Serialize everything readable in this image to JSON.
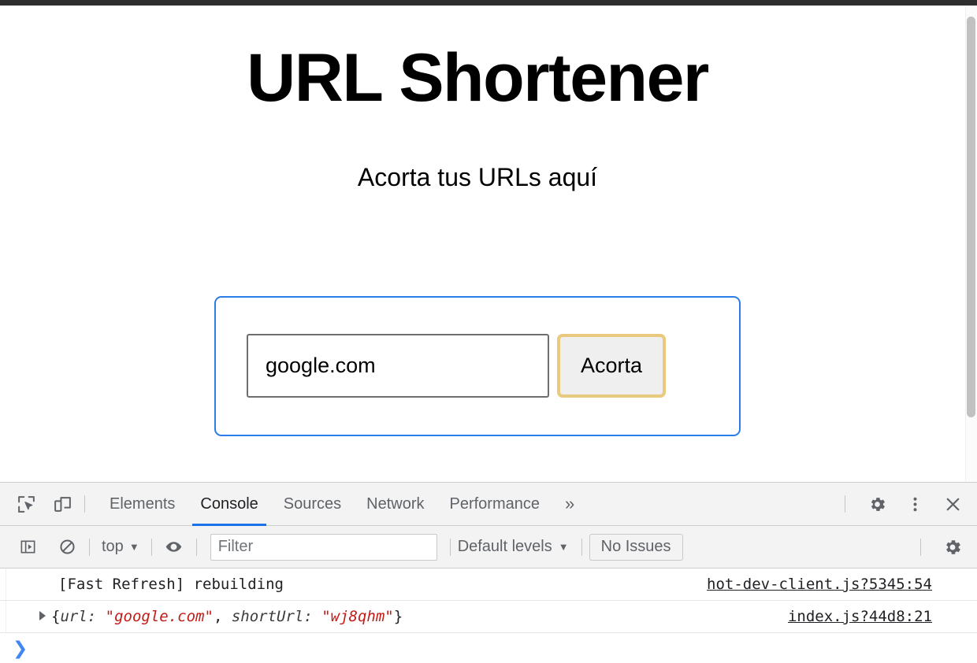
{
  "page": {
    "title": "URL Shortener",
    "subtitle": "Acorta tus URLs aquí",
    "form": {
      "url_value": "google.com",
      "url_placeholder": "",
      "submit_label": "Acorta"
    },
    "colors": {
      "form_border": "#2b7de9",
      "button_border": "#e9c97d",
      "button_bg": "#efefef"
    }
  },
  "devtools": {
    "tabs": [
      {
        "label": "Elements",
        "active": false
      },
      {
        "label": "Console",
        "active": true
      },
      {
        "label": "Sources",
        "active": false
      },
      {
        "label": "Network",
        "active": false
      },
      {
        "label": "Performance",
        "active": false
      }
    ],
    "overflow_label": "»",
    "icons": {
      "inspect": "inspect-element-icon",
      "device": "device-toolbar-icon",
      "settings": "gear-icon",
      "menu": "kebab-menu-icon",
      "close": "close-icon",
      "sidebar": "console-sidebar-icon",
      "clear": "clear-console-icon",
      "eye": "live-expression-icon"
    },
    "filterbar": {
      "context": "top",
      "filter_placeholder": "Filter",
      "filter_value": "",
      "levels": "Default levels",
      "issues": "No Issues"
    },
    "console": {
      "rows": [
        {
          "kind": "log",
          "text": "[Fast Refresh] rebuilding",
          "source": "hot-dev-client.js?5345:54"
        },
        {
          "kind": "object",
          "prefix": "{",
          "key1": "url: ",
          "val1": "\"google.com\"",
          "comma": ", ",
          "key2": "shortUrl: ",
          "val2": "\"wj8qhm\"",
          "suffix": "}",
          "source": "index.js?44d8:21"
        }
      ],
      "prompt": "❯"
    }
  }
}
